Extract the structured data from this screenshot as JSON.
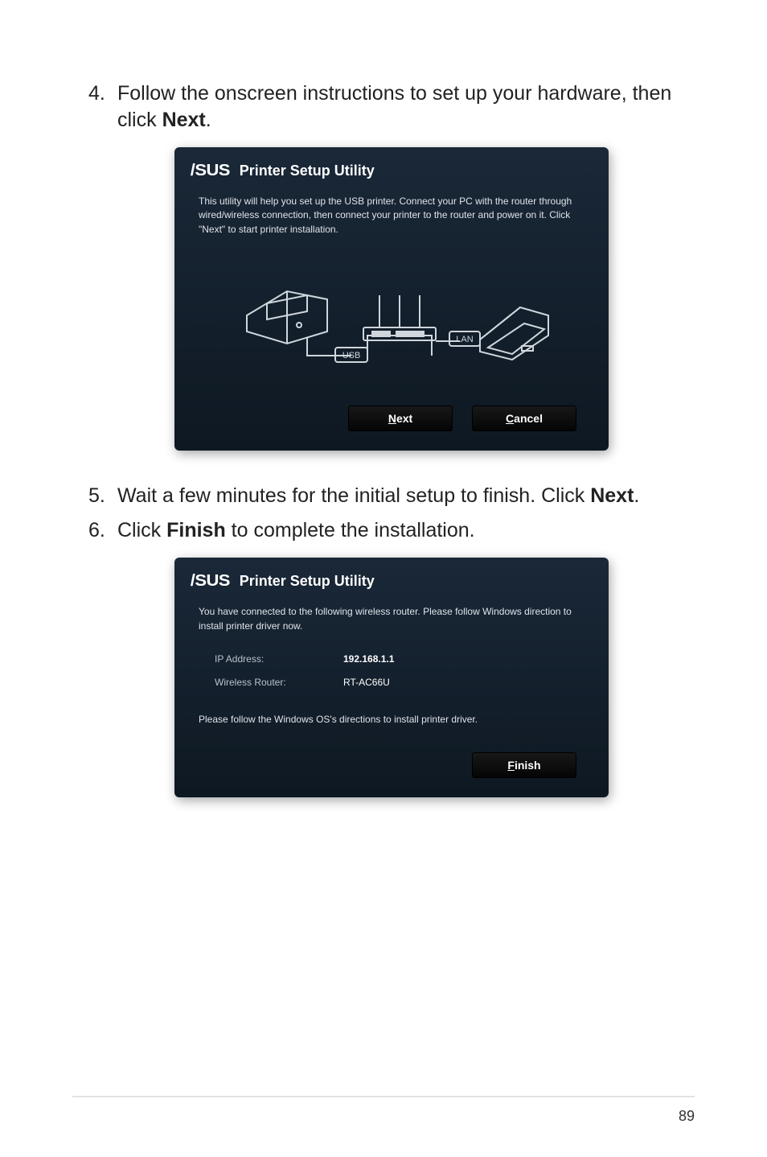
{
  "steps": {
    "s4": {
      "num": "4.",
      "text_before": "Follow the onscreen instructions to set up your hardware, then click ",
      "bold": "Next",
      "text_after": "."
    },
    "s5": {
      "num": "5.",
      "text_before": "Wait a few minutes for the initial setup to finish. Click ",
      "bold": "Next",
      "text_after": "."
    },
    "s6": {
      "num": "6.",
      "text_before": "Click ",
      "bold": "Finish",
      "text_after": " to complete the installation."
    }
  },
  "dialog1": {
    "logo": "/SUS",
    "title": "Printer Setup Utility",
    "message": "This utility will help you set up the USB printer. Connect your PC with the router through wired/wireless connection, then connect your printer to the router and power on it. Click \"Next\" to start printer installation.",
    "diagram": {
      "usb_label": "USB",
      "lan_label": "LAN"
    },
    "buttons": {
      "next": {
        "u": "N",
        "rest": "ext"
      },
      "cancel": {
        "u": "C",
        "rest": "ancel"
      }
    }
  },
  "dialog2": {
    "logo": "/SUS",
    "title": "Printer Setup Utility",
    "message": "You have connected to the following wireless router. Please follow Windows direction to install printer driver now.",
    "ip_label": "IP Address:",
    "ip_value": "192.168.1.1",
    "router_label": "Wireless Router:",
    "router_value": "RT-AC66U",
    "note": "Please follow the Windows OS's directions to install printer driver.",
    "buttons": {
      "finish": {
        "u": "F",
        "rest": "inish"
      }
    }
  },
  "page_number": "89"
}
